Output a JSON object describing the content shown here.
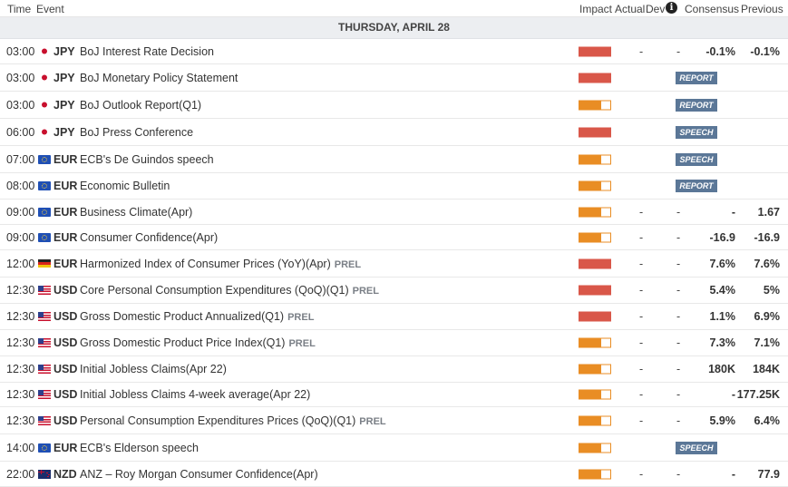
{
  "colors": {
    "impact_high": "#d95749",
    "impact_medium": "#e98d24",
    "badge": "#5b7797",
    "day_band": "#eceef1"
  },
  "header": {
    "time": "Time",
    "event": "Event",
    "impact": "Impact",
    "actual": "Actual",
    "dev": "Dev",
    "info_icon": "i",
    "consensus": "Consensus",
    "previous": "Previous"
  },
  "day": "THURSDAY, APRIL 28",
  "events": [
    {
      "time": "03:00",
      "flag": "jp",
      "currency": "JPY",
      "name": "BoJ Interest Rate Decision",
      "prel": "",
      "impact": "high",
      "actual": "-",
      "dev": "-",
      "consensus": "-0.1%",
      "previous": "-0.1%",
      "badge": ""
    },
    {
      "time": "03:00",
      "flag": "jp",
      "currency": "JPY",
      "name": "BoJ Monetary Policy Statement",
      "prel": "",
      "impact": "high",
      "actual": "",
      "dev": "",
      "consensus": "",
      "previous": "",
      "badge": "REPORT"
    },
    {
      "time": "03:00",
      "flag": "jp",
      "currency": "JPY",
      "name": "BoJ Outlook Report(Q1)",
      "prel": "",
      "impact": "medium",
      "actual": "",
      "dev": "",
      "consensus": "",
      "previous": "",
      "badge": "REPORT"
    },
    {
      "time": "06:00",
      "flag": "jp",
      "currency": "JPY",
      "name": "BoJ Press Conference",
      "prel": "",
      "impact": "high",
      "actual": "",
      "dev": "",
      "consensus": "",
      "previous": "",
      "badge": "SPEECH"
    },
    {
      "time": "07:00",
      "flag": "eu",
      "currency": "EUR",
      "name": "ECB's De Guindos speech",
      "prel": "",
      "impact": "medium",
      "actual": "",
      "dev": "",
      "consensus": "",
      "previous": "",
      "badge": "SPEECH"
    },
    {
      "time": "08:00",
      "flag": "eu",
      "currency": "EUR",
      "name": "Economic Bulletin",
      "prel": "",
      "impact": "medium",
      "actual": "",
      "dev": "",
      "consensus": "",
      "previous": "",
      "badge": "REPORT"
    },
    {
      "time": "09:00",
      "flag": "eu",
      "currency": "EUR",
      "name": "Business Climate(Apr)",
      "prel": "",
      "impact": "medium",
      "actual": "-",
      "dev": "-",
      "consensus": "-",
      "previous": "1.67",
      "badge": ""
    },
    {
      "time": "09:00",
      "flag": "eu",
      "currency": "EUR",
      "name": "Consumer Confidence(Apr)",
      "prel": "",
      "impact": "medium",
      "actual": "-",
      "dev": "-",
      "consensus": "-16.9",
      "previous": "-16.9",
      "badge": ""
    },
    {
      "time": "12:00",
      "flag": "de",
      "currency": "EUR",
      "name": "Harmonized Index of Consumer Prices (YoY)(Apr)",
      "prel": "PREL",
      "impact": "high",
      "actual": "-",
      "dev": "-",
      "consensus": "7.6%",
      "previous": "7.6%",
      "badge": ""
    },
    {
      "time": "12:30",
      "flag": "us",
      "currency": "USD",
      "name": "Core Personal Consumption Expenditures (QoQ)(Q1)",
      "prel": "PREL",
      "impact": "high",
      "actual": "-",
      "dev": "-",
      "consensus": "5.4%",
      "previous": "5%",
      "badge": ""
    },
    {
      "time": "12:30",
      "flag": "us",
      "currency": "USD",
      "name": "Gross Domestic Product Annualized(Q1)",
      "prel": "PREL",
      "impact": "high",
      "actual": "-",
      "dev": "-",
      "consensus": "1.1%",
      "previous": "6.9%",
      "badge": ""
    },
    {
      "time": "12:30",
      "flag": "us",
      "currency": "USD",
      "name": "Gross Domestic Product Price Index(Q1)",
      "prel": "PREL",
      "impact": "medium",
      "actual": "-",
      "dev": "-",
      "consensus": "7.3%",
      "previous": "7.1%",
      "badge": ""
    },
    {
      "time": "12:30",
      "flag": "us",
      "currency": "USD",
      "name": "Initial Jobless Claims(Apr 22)",
      "prel": "",
      "impact": "medium",
      "actual": "-",
      "dev": "-",
      "consensus": "180K",
      "previous": "184K",
      "badge": ""
    },
    {
      "time": "12:30",
      "flag": "us",
      "currency": "USD",
      "name": "Initial Jobless Claims 4-week average(Apr 22)",
      "prel": "",
      "impact": "medium",
      "actual": "-",
      "dev": "-",
      "consensus": "-",
      "previous": "177.25K",
      "badge": ""
    },
    {
      "time": "12:30",
      "flag": "us",
      "currency": "USD",
      "name": "Personal Consumption Expenditures Prices (QoQ)(Q1)",
      "prel": "PREL",
      "impact": "medium",
      "actual": "-",
      "dev": "-",
      "consensus": "5.9%",
      "previous": "6.4%",
      "badge": ""
    },
    {
      "time": "14:00",
      "flag": "eu",
      "currency": "EUR",
      "name": "ECB's Elderson speech",
      "prel": "",
      "impact": "medium",
      "actual": "",
      "dev": "",
      "consensus": "",
      "previous": "",
      "badge": "SPEECH"
    },
    {
      "time": "22:00",
      "flag": "nz",
      "currency": "NZD",
      "name": "ANZ – Roy Morgan Consumer Confidence(Apr)",
      "prel": "",
      "impact": "medium",
      "actual": "-",
      "dev": "-",
      "consensus": "-",
      "previous": "77.9",
      "badge": ""
    }
  ]
}
